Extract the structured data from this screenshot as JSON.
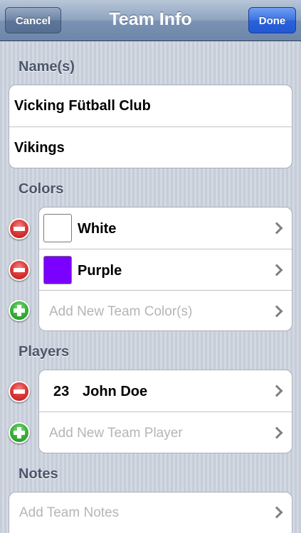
{
  "navbar": {
    "title": "Team Info",
    "cancel_label": "Cancel",
    "done_label": "Done"
  },
  "names": {
    "header": "Name(s)",
    "items": [
      "Vicking Fütball Club",
      "Vikings"
    ]
  },
  "colors": {
    "header": "Colors",
    "items": [
      {
        "name": "White",
        "swatch": "#ffffff"
      },
      {
        "name": "Purple",
        "swatch": "#7a00ff"
      }
    ],
    "add_label": "Add New Team Color(s)"
  },
  "players": {
    "header": "Players",
    "items": [
      {
        "number": "23",
        "name": "John Doe"
      }
    ],
    "add_label": "Add New Team Player"
  },
  "notes": {
    "header": "Notes",
    "add_label": "Add Team Notes"
  },
  "icons": {
    "remove": "minus-circle-icon",
    "add": "plus-circle-icon",
    "disclosure": "chevron-right-icon"
  },
  "theme": {
    "nav_bar": "#7b92b3",
    "done_button": "#2962dc",
    "remove_control": "#de3a3a",
    "add_control": "#3cb63c",
    "section_header": "#4c566b",
    "placeholder_text": "#b5b5b5"
  }
}
